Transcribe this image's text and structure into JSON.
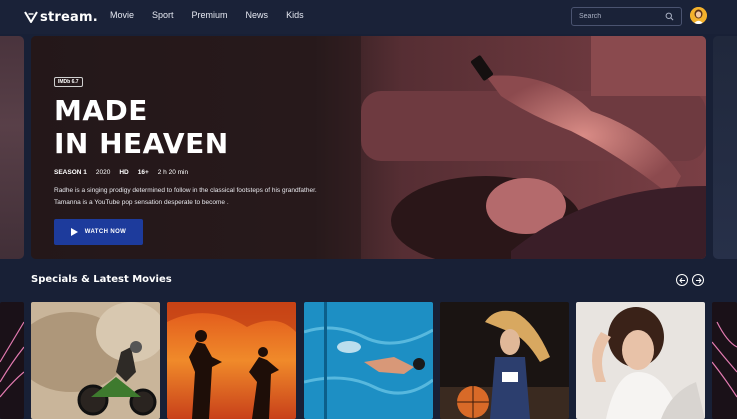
{
  "brand": {
    "logo_text": "stream.",
    "accent": "#1d3b9c",
    "background": "#182036"
  },
  "nav": {
    "items": [
      "Movie",
      "Sport",
      "Premium",
      "News",
      "Kids"
    ]
  },
  "search": {
    "placeholder": "Search",
    "icon": "search-icon"
  },
  "user": {
    "avatar": "avatar"
  },
  "hero": {
    "imdb": "IMDb 6.7",
    "title_line1": "MADE",
    "title_line2": "IN HEAVEN",
    "season": "SEASON 1",
    "year": "2020",
    "quality": "HD",
    "rating": "16+",
    "duration": "2 h 20 min",
    "description": "Radhe is a singing prodigy determined to follow in the classical footsteps of his grandfather. Tamanna is a YouTube pop sensation desperate to become .",
    "button_label": "WATCH NOW"
  },
  "section": {
    "title": "Specials & Latest Movies",
    "prev_icon": "arrow-left-icon",
    "next_icon": "arrow-right-icon"
  }
}
